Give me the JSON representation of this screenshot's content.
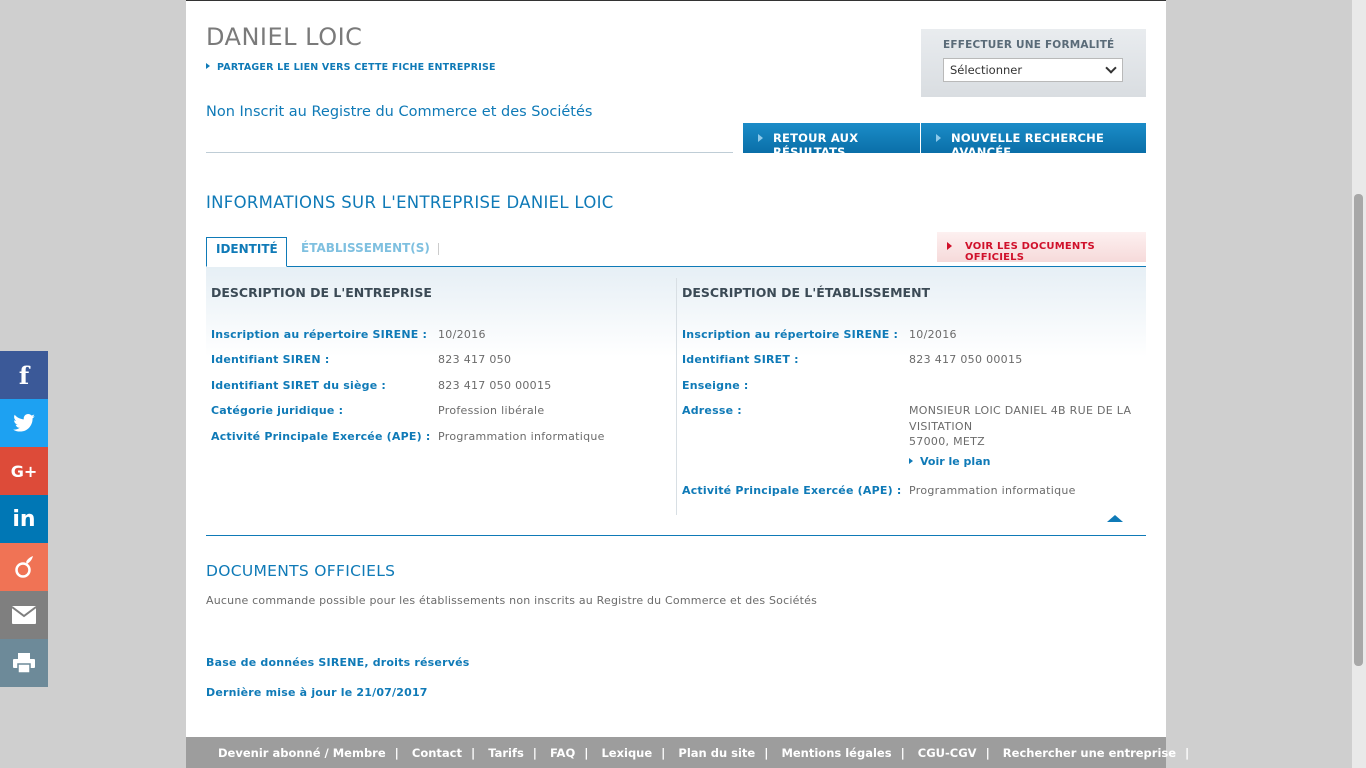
{
  "header": {
    "company_name": "DANIEL LOIC",
    "share_link": "PARTAGER LE LIEN VERS CETTE FICHE ENTREPRISE",
    "rcs_status": "Non Inscrit au Registre du Commerce et des Sociétés"
  },
  "formalite": {
    "label": "EFFECTUER UNE FORMALITÉ",
    "selected": "Sélectionner"
  },
  "buttons": {
    "back": "RETOUR AUX RÉSULTATS",
    "new_search": "NOUVELLE RECHERCHE AVANCÉE"
  },
  "section": {
    "title": "INFORMATIONS SUR L'ENTREPRISE DANIEL LOIC"
  },
  "tabs": {
    "identite": "IDENTITÉ",
    "etablissements": "ÉTABLISSEMENT(S)",
    "documents_button": "VOIR LES DOCUMENTS OFFICIELS"
  },
  "entreprise": {
    "title": "DESCRIPTION DE L'ENTREPRISE",
    "rows": [
      {
        "label": "Inscription au répertoire SIRENE :",
        "value": "10/2016"
      },
      {
        "label": "Identifiant SIREN :",
        "value": "823 417 050"
      },
      {
        "label": "Identifiant SIRET du siège :",
        "value": "823 417 050 00015"
      },
      {
        "label": "Catégorie juridique :",
        "value": "Profession libérale"
      },
      {
        "label": "Activité Principale Exercée (APE) :",
        "value": "Programmation informatique"
      }
    ]
  },
  "etablissement": {
    "title": "DESCRIPTION DE L'ÉTABLISSEMENT",
    "rows": [
      {
        "label": "Inscription au répertoire SIRENE :",
        "value": "10/2016"
      },
      {
        "label": "Identifiant SIRET :",
        "value": "823 417 050 00015"
      },
      {
        "label": "Enseigne :",
        "value": ""
      },
      {
        "label": "Adresse :",
        "value": "MONSIEUR LOIC DANIEL 4B RUE DE LA"
      },
      {
        "label": "Activité Principale Exercée (APE) :",
        "value": "Programmation informatique"
      }
    ],
    "address_line2": "VISITATION",
    "address_line3": "57000,  METZ",
    "map_link": "Voir le plan"
  },
  "documents": {
    "title": "DOCUMENTS OFFICIELS",
    "text": "Aucune commande possible pour les établissements non inscrits au Registre du Commerce et des Sociétés"
  },
  "sources": {
    "database": "Base de données SIRENE, droits réservés",
    "last_update": "Dernière mise à jour le 21/07/2017"
  },
  "footer": {
    "links": [
      "Devenir abonné / Membre",
      "Contact",
      "Tarifs",
      "FAQ",
      "Lexique",
      "Plan du site",
      "Mentions légales",
      "CGU-CGV",
      "Rechercher une entreprise"
    ],
    "separator": "|"
  },
  "social": {
    "facebook": "f",
    "google": "G+",
    "linkedin": "in",
    "colors": {
      "facebook": "#3b5998",
      "twitter": "#1da1f2",
      "google": "#dd4b39",
      "linkedin": "#0077b5",
      "viadeo": "#f07355",
      "email": "#7f7f7f",
      "print": "#6d8a99"
    }
  }
}
